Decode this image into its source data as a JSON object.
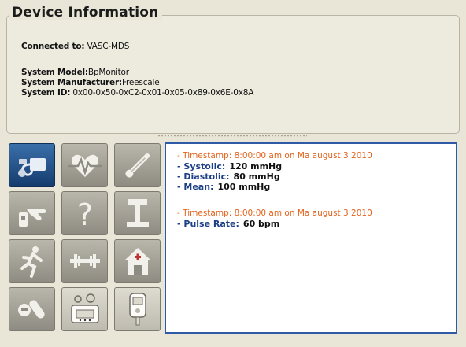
{
  "device_info": {
    "title": "Device Information",
    "connected_label": "Connected to:",
    "connected_value": "VASC-MDS",
    "model_label": "System Model:",
    "model_value": "BpMonitor",
    "manufacturer_label": "System Manufacturer:",
    "manufacturer_value": "Freescale",
    "id_label": "System ID:",
    "id_value": "0x00-0x50-0xC2-0x01-0x05-0x89-0x6E-0x8A"
  },
  "icons": [
    {
      "name": "blood-pressure-icon",
      "selected": true
    },
    {
      "name": "heart-rate-icon",
      "selected": false
    },
    {
      "name": "thermometer-icon",
      "selected": false
    },
    {
      "name": "hand-pointer-icon",
      "selected": false
    },
    {
      "name": "question-mark-icon",
      "selected": false
    },
    {
      "name": "weight-scale-icon",
      "selected": false
    },
    {
      "name": "running-person-icon",
      "selected": false
    },
    {
      "name": "dumbbell-icon",
      "selected": false
    },
    {
      "name": "home-health-icon",
      "selected": false
    },
    {
      "name": "pills-icon",
      "selected": false
    },
    {
      "name": "device-monitor-icon",
      "selected": false
    },
    {
      "name": "glucose-meter-icon",
      "selected": false
    }
  ],
  "readings": {
    "bp_timestamp": "- Timestamp: 8:00:00 am on Ma august 3 2010",
    "systolic_label": "- Systolic:",
    "systolic_value": "120 mmHg",
    "diastolic_label": "- Diastolic:",
    "diastolic_value": "80 mmHg",
    "mean_label": "- Mean:",
    "mean_value": "100 mmHg",
    "pulse_timestamp": "- Timestamp: 8:00:00 am on Ma august 3 2010",
    "pulse_label": "- Pulse Rate:",
    "pulse_value": "60 bpm"
  },
  "colors": {
    "accent_border": "#2e5aa8",
    "timestamp": "#e2641e",
    "label": "#1d3f86",
    "selected_tile": "#153c6e"
  }
}
